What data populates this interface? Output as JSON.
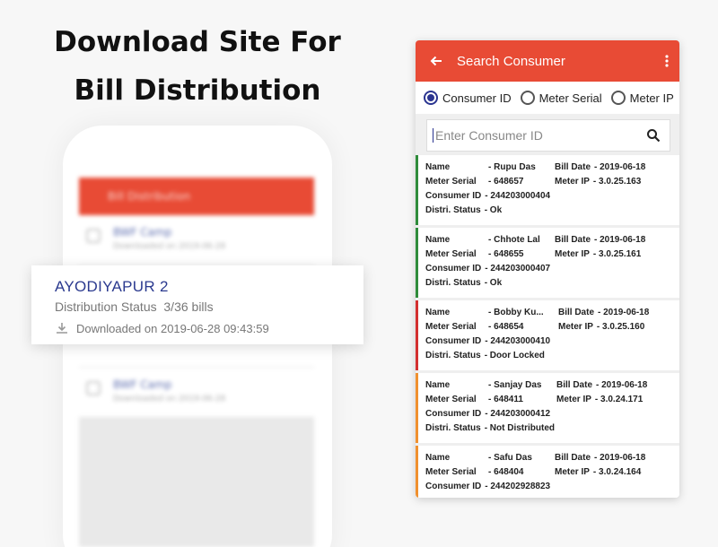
{
  "headline": [
    "Download Site For",
    "Bill Distribution"
  ],
  "left_phone": {
    "blurred_title": "Bill Distribution",
    "blurred_rows": [
      {
        "name": "BWF Camp",
        "sub": "Downloaded on 2019-06-28"
      },
      {
        "name": "BWF Camp",
        "sub": "Downloaded on 2019-06-28"
      }
    ],
    "site_card": {
      "name": "AYODIYAPUR 2",
      "status_label": "Distribution Status",
      "status_value": "3/36 bills",
      "downloaded": "Downloaded on 2019-06-28 09:43:59"
    }
  },
  "app": {
    "title": "Search Consumer",
    "radios": [
      "Consumer ID",
      "Meter Serial",
      "Meter IP"
    ],
    "selected_radio": "Consumer ID",
    "search_placeholder": "Enter Consumer ID",
    "labels": {
      "name": "Name",
      "meter_serial": "Meter Serial",
      "consumer_id": "Consumer ID",
      "status": "Distri. Status",
      "bill_date": "Bill Date",
      "meter_ip": "Meter IP"
    },
    "consumers": [
      {
        "name": "- Rupu Das",
        "serial": "- 648657",
        "consumer_id": "- 244203000404",
        "status": "- Ok",
        "bill_date": "- 2019-06-18",
        "meter_ip": "- 3.0.25.163",
        "status_color": "#2e8b3a"
      },
      {
        "name": "- Chhote Lal",
        "serial": "- 648655",
        "consumer_id": "- 244203000407",
        "status": "- Ok",
        "bill_date": "- 2019-06-18",
        "meter_ip": "- 3.0.25.161",
        "status_color": "#2e8b3a"
      },
      {
        "name": "- Bobby Ku...",
        "serial": "- 648654",
        "consumer_id": "- 244203000410",
        "status": "- Door Locked",
        "bill_date": "- 2019-06-18",
        "meter_ip": "- 3.0.25.160",
        "status_color": "#d32f2f"
      },
      {
        "name": "- Sanjay Das",
        "serial": "- 648411",
        "consumer_id": "- 244203000412",
        "status": "- Not Distributed",
        "bill_date": "- 2019-06-18",
        "meter_ip": "- 3.0.24.171",
        "status_color": "#f0902e"
      },
      {
        "name": "- Safu Das",
        "serial": "- 648404",
        "consumer_id": "- 244202928823",
        "status": "",
        "bill_date": "- 2019-06-18",
        "meter_ip": "- 3.0.24.164",
        "status_color": "#f0902e"
      }
    ]
  },
  "colors": {
    "accent": "#e84b35",
    "primary": "#2a3490"
  }
}
